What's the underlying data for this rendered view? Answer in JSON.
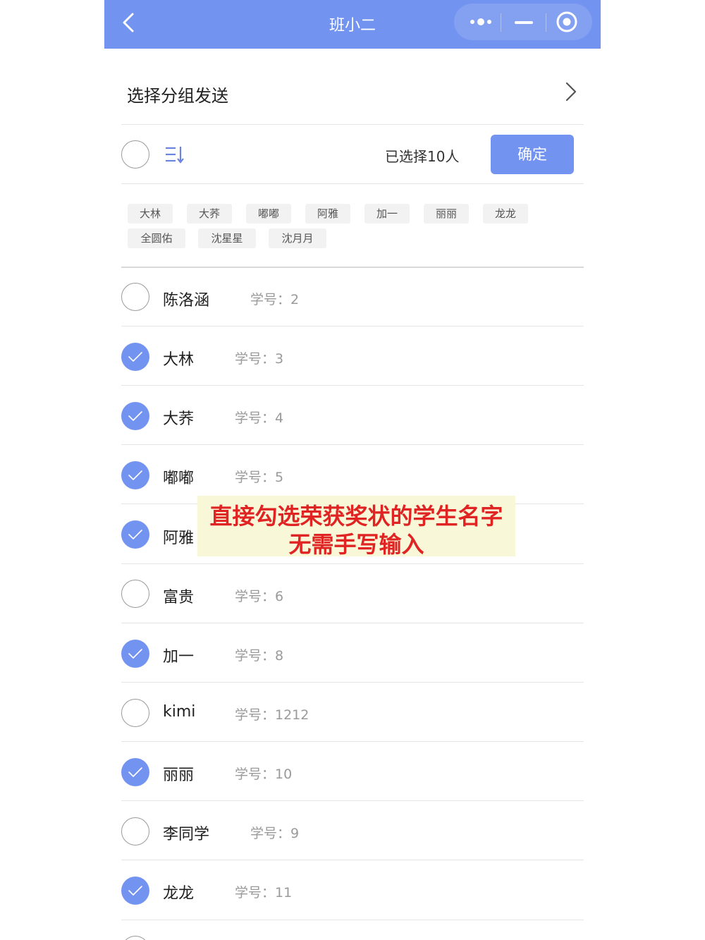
{
  "navbar": {
    "title": "班小二",
    "color": "#7393f0"
  },
  "group": {
    "label": "选择分组发送"
  },
  "toolbar": {
    "selected_text": "已选择10人",
    "confirm_label": "确定"
  },
  "chips": [
    "大林",
    "大荞",
    "嘟嘟",
    "阿雅",
    "加一",
    "丽丽",
    "龙龙",
    "全圆佑",
    "沈星星",
    "沈月月"
  ],
  "students": [
    {
      "name": "陈洛涵",
      "no": "学号：2",
      "checked": false
    },
    {
      "name": "大林",
      "no": "学号：3",
      "checked": true
    },
    {
      "name": "大荞",
      "no": "学号：4",
      "checked": true
    },
    {
      "name": "嘟嘟",
      "no": "学号：5",
      "checked": true
    },
    {
      "name": "阿雅",
      "no": "",
      "checked": true
    },
    {
      "name": "富贵",
      "no": "学号：6",
      "checked": false
    },
    {
      "name": "加一",
      "no": "学号：8",
      "checked": true
    },
    {
      "name": "kimi",
      "no": "学号：1212",
      "checked": false
    },
    {
      "name": "丽丽",
      "no": "学号：10",
      "checked": true
    },
    {
      "name": "李同学",
      "no": "学号：9",
      "checked": false
    },
    {
      "name": "龙龙",
      "no": "学号：11",
      "checked": true
    }
  ],
  "overlay": {
    "line1": "直接勾选荣获奖状的学生名字",
    "line2": "无需手写输入"
  },
  "icons": [
    "back-arrow-icon",
    "more-dots-icon",
    "minimize-icon",
    "close-target-icon",
    "chevron-right-icon",
    "sort-icon",
    "check-icon"
  ],
  "colors": {
    "accent": "#7393f0",
    "overlay_text": "#e02424",
    "overlay_bg": "#f8f7d8"
  }
}
